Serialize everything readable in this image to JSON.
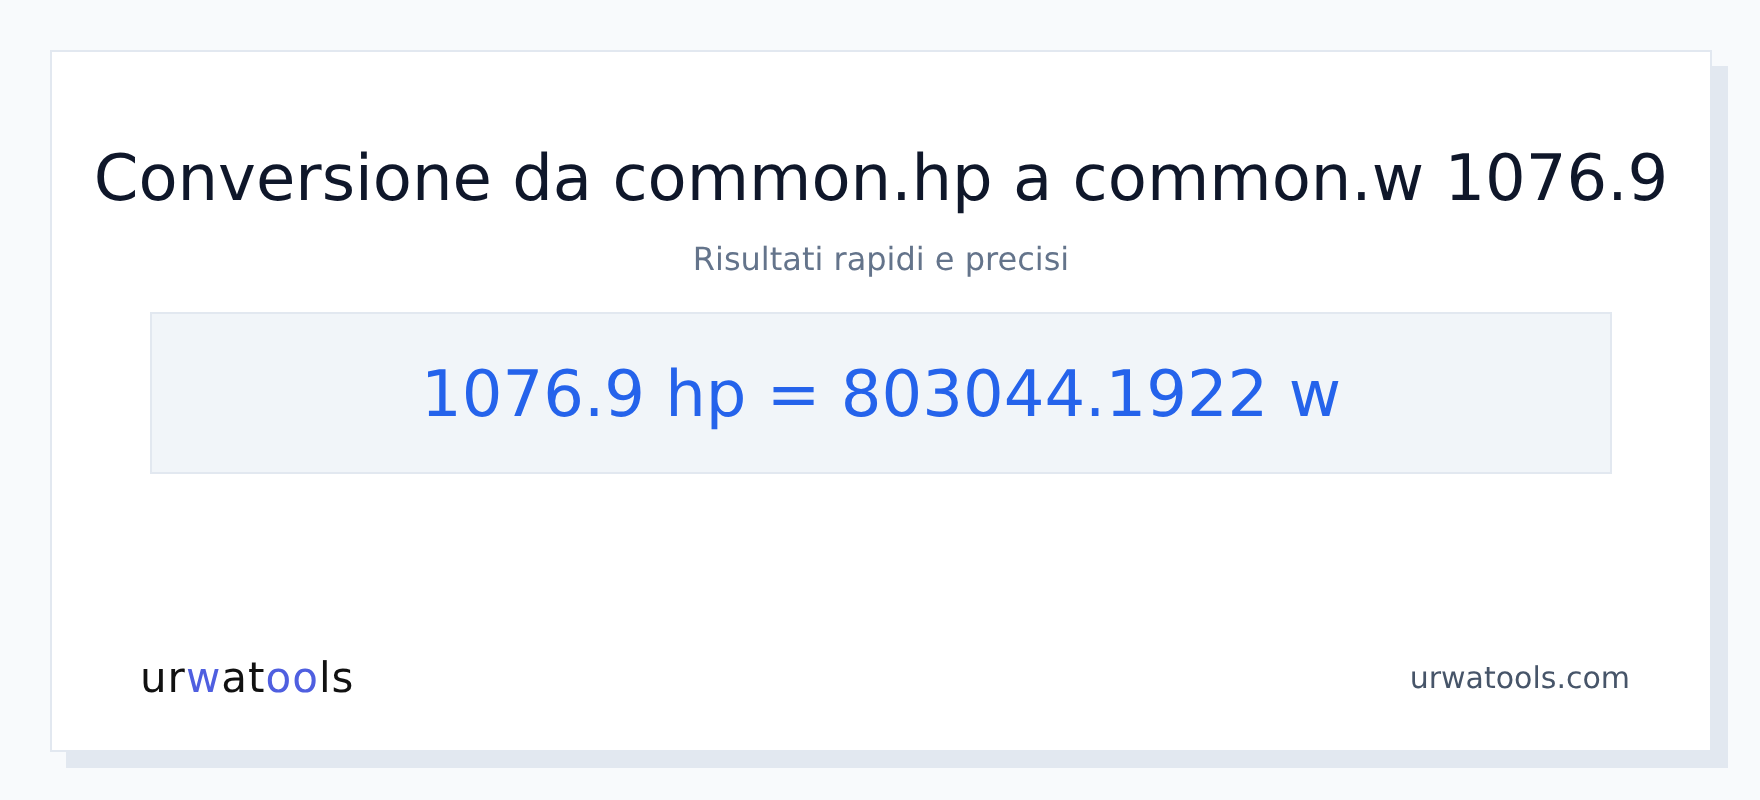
{
  "title": "Conversione da common.hp a common.w 1076.9",
  "subtitle": "Risultati rapidi e precisi",
  "result": "1076.9 hp = 803044.1922 w",
  "logo": [
    {
      "text": "ur",
      "accent": false
    },
    {
      "text": "w",
      "accent": true
    },
    {
      "text": "at",
      "accent": false
    },
    {
      "text": "oo",
      "accent": true
    },
    {
      "text": "ls",
      "accent": false
    }
  ],
  "site": "urwatools.com"
}
